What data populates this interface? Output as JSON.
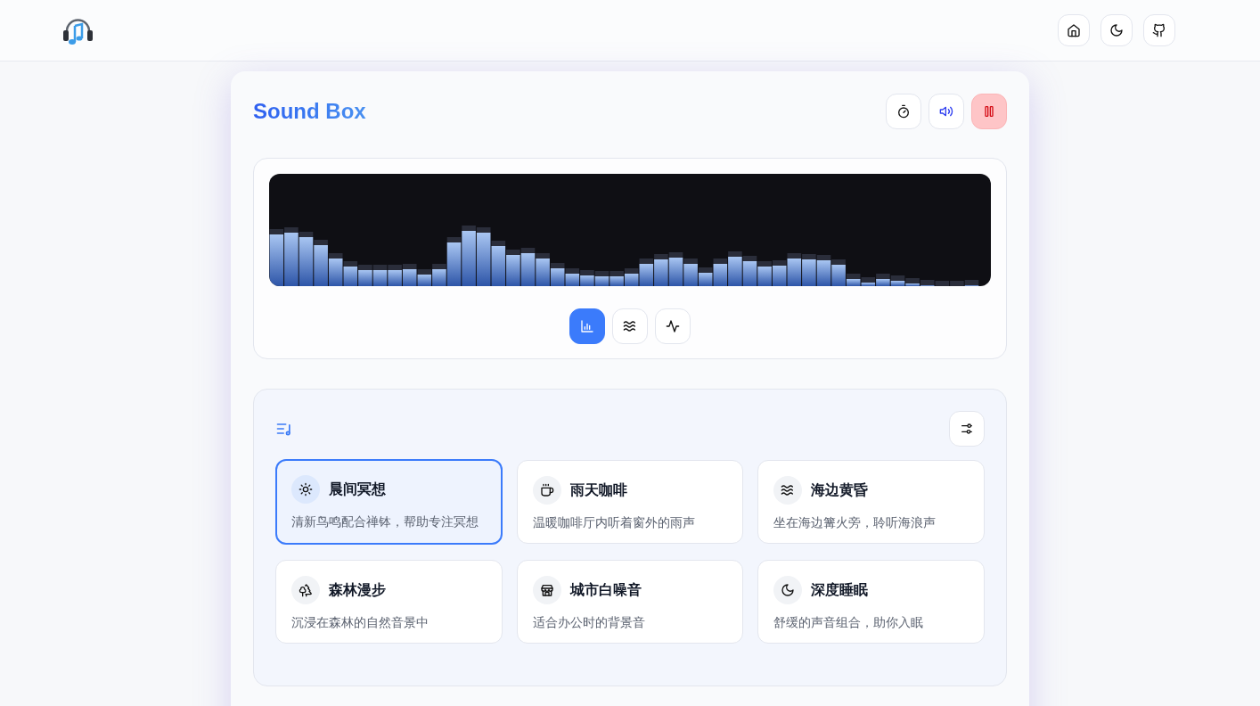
{
  "app": {
    "title": "Sound Box",
    "playing": true
  },
  "visualizer": {
    "modes": [
      {
        "kind": "bars",
        "selected": true
      },
      {
        "kind": "waves",
        "selected": false
      },
      {
        "kind": "pulse",
        "selected": false
      }
    ]
  },
  "presets": [
    {
      "kind": "sun",
      "title": "晨间冥想",
      "description": "清新鸟鸣配合禅钵，帮助专注冥想",
      "selected": true
    },
    {
      "kind": "coffee",
      "title": "雨天咖啡",
      "description": "温暖咖啡厅内听着窗外的雨声",
      "selected": false
    },
    {
      "kind": "waves",
      "title": "海边黄昏",
      "description": "坐在海边篝火旁，聆听海浪声",
      "selected": false
    },
    {
      "kind": "trees",
      "title": "森林漫步",
      "description": "沉浸在森林的自然音景中",
      "selected": false
    },
    {
      "kind": "store",
      "title": "城市白噪音",
      "description": "适合办公时的背景音",
      "selected": false
    },
    {
      "kind": "moon",
      "title": "深度睡眠",
      "description": "舒缓的声音组合，助你入眠",
      "selected": false
    }
  ]
}
